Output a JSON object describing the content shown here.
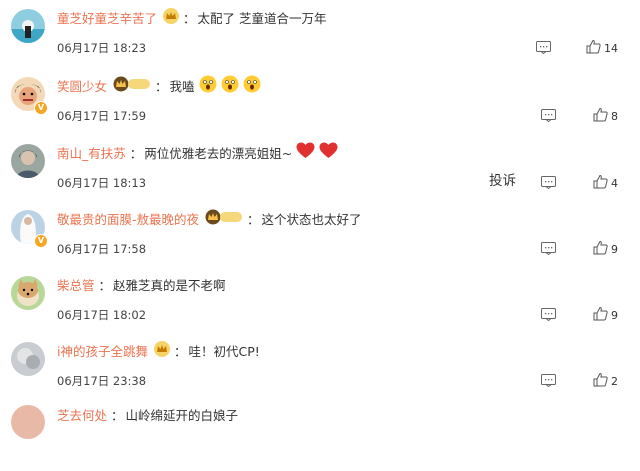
{
  "comments": [
    {
      "username": "童芝好童芝辛苦了",
      "text": "太配了 芝童道合一万年",
      "time": "06月17日 18:23",
      "likes": "14",
      "avatar": "beach-avatar"
    },
    {
      "username": "笑圆少女",
      "text": "我嗑",
      "time": "06月17日 17:59",
      "likes": "8",
      "avatar": "cartoon-avatar",
      "badge_level": "II",
      "verified": "V"
    },
    {
      "username": "南山_有扶苏",
      "text": "两位优雅老去的漂亮姐姐~",
      "time": "06月17日 18:13",
      "likes": "4",
      "avatar": "portrait-avatar",
      "report_label": "投诉"
    },
    {
      "username": "敬最贵的面膜-敖最晚的夜",
      "text": "这个状态也太好了",
      "time": "06月17日 17:58",
      "likes": "9",
      "avatar": "bride-avatar",
      "badge_level": "I",
      "verified": "V"
    },
    {
      "username": "柴总管",
      "text": "赵雅芝真的是不老啊",
      "time": "06月17日 18:02",
      "likes": "9",
      "avatar": "dog-avatar"
    },
    {
      "username": "i神的孩子全跳舞",
      "text": "哇！初代CP!",
      "time": "06月17日 23:38",
      "likes": "2",
      "avatar": "blur-avatar"
    }
  ],
  "partial_row": {
    "username": "芝去何处",
    "text": "山岭绵延开的白娘子"
  },
  "colors": {
    "username": "#eb7350",
    "text": "#333333",
    "badge_gold": "#f5a623",
    "heart_red": "#e03030"
  }
}
